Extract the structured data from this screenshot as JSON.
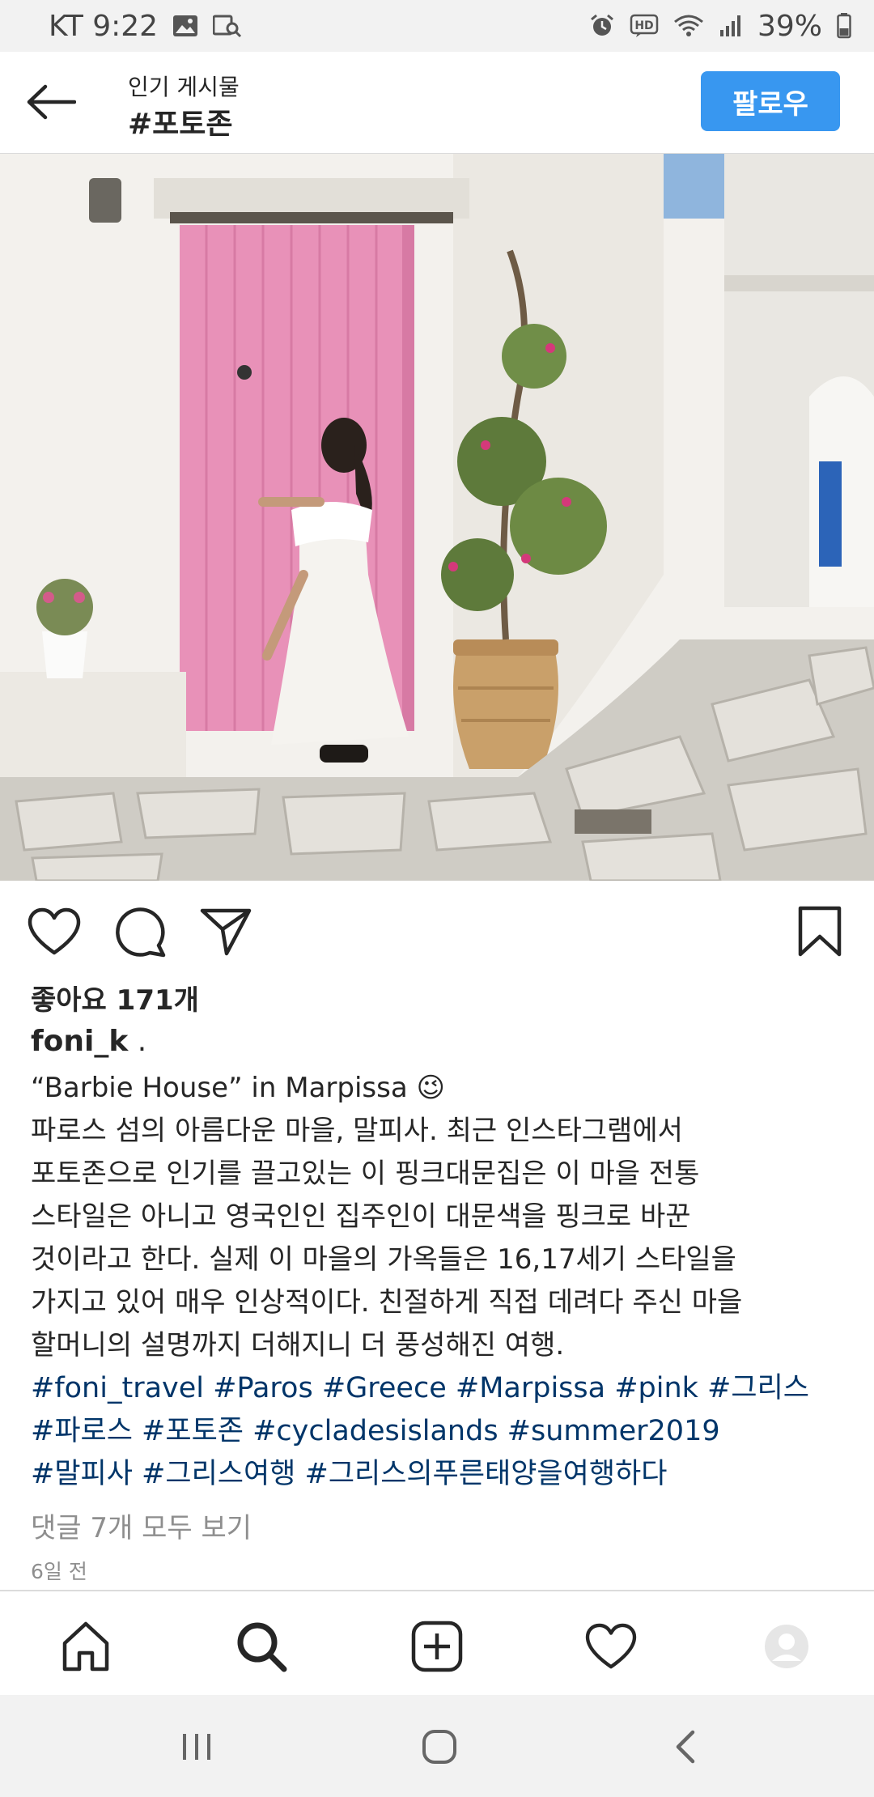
{
  "status_bar": {
    "carrier_time": "KT 9:22",
    "battery": "39%",
    "icons": [
      "image-icon",
      "search-image-icon",
      "alarm-icon",
      "hd-icon",
      "wifi-icon",
      "signal-icon",
      "battery-icon"
    ]
  },
  "header": {
    "subtitle": "인기 게시물",
    "title": "#포토존",
    "follow_label": "팔로우",
    "accent_color": "#3897f0"
  },
  "post": {
    "likes": "좋아요 171개",
    "username": "foni_k",
    "username_suffix": " .",
    "caption_title": "“Barbie House” in Marpissa",
    "caption_emoji": "😉",
    "caption_lines": [
      "파로스 섬의 아름다운 마을, 말피사. 최근 인스타그램에서",
      "포토존으로 인기를 끌고있는 이 핑크대문집은 이 마을 전통",
      "스타일은 아니고 영국인인 집주인이 대문색을 핑크로 바꾼",
      "것이라고 한다. 실제 이 마을의 가옥들은 16,17세기 스타일을",
      "가지고 있어 매우 인상적이다. 친절하게 직접 데려다 주신 마을",
      "할머니의 설명까지 더해지니 더 풍성해진 여행."
    ],
    "hashtag_lines": [
      "#foni_travel #Paros #Greece #Marpissa #pink #그리스",
      "#파로스 #포토존 #cycladesislands #summer2019",
      "#말피사 #그리스여행 #그리스의푸른태양을여행하다"
    ],
    "hashtag_color": "#003569",
    "comments_link": "댓글 7개 모두 보기",
    "time_ago": "6일 전"
  },
  "bottom_nav": [
    "home-icon",
    "search-icon",
    "add-post-icon",
    "activity-heart-icon",
    "profile-avatar"
  ],
  "system_nav": [
    "recent-apps-icon",
    "home-circle-icon",
    "back-chevron-icon"
  ]
}
